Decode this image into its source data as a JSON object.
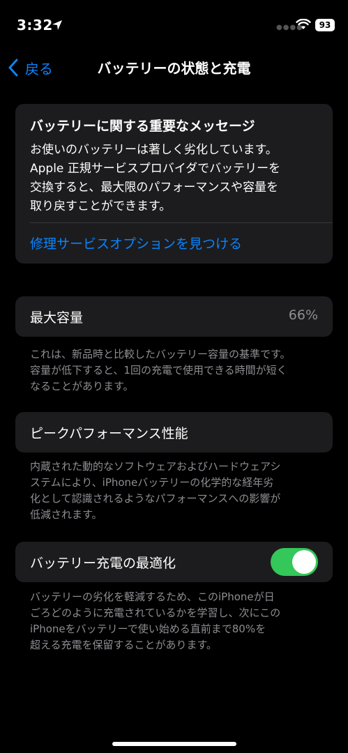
{
  "status_bar": {
    "time": "3:32",
    "battery_level": "93"
  },
  "nav": {
    "back_label": "戻る",
    "title": "バッテリーの状態と充電"
  },
  "message_card": {
    "title": "バッテリーに関する重要なメッセージ",
    "body_lines": [
      "お使いのバッテリーは著しく劣化しています。",
      "Apple 正規サービスプロバイダでバッテリーを",
      "交換すると、最大限のパフォーマンスや容量を",
      "取り戻すことができます。"
    ],
    "link": "修理サービスオプションを見つける"
  },
  "max_capacity": {
    "label": "最大容量",
    "value": "66%",
    "footnote_lines": [
      "これは、新品時と比較したバッテリー容量の基準です。",
      "容量が低下すると、1回の充電で使用できる時間が短く",
      "なることがあります。"
    ]
  },
  "peak_performance": {
    "label": "ピークパフォーマンス性能",
    "footnote_lines": [
      "内蔵された動的なソフトウェアおよびハードウェアシ",
      "ステムにより、iPhoneバッテリーの化学的な経年劣",
      "化として認識されるようなパフォーマンスへの影響が",
      "低減されます。"
    ]
  },
  "optimized_charging": {
    "label": "バッテリー充電の最適化",
    "enabled": true,
    "footnote_lines": [
      "バッテリーの劣化を軽減するため、このiPhoneが日",
      "ごろどのように充電されているかを学習し、次にこの",
      "iPhoneをバッテリーで使い始める直前まで80%を",
      "超える充電を保留することがあります。"
    ]
  },
  "colors": {
    "accent": "#0a84ff",
    "toggle_on": "#34c759",
    "card_bg": "#1c1c1e",
    "secondary_text": "#8e8e93"
  }
}
